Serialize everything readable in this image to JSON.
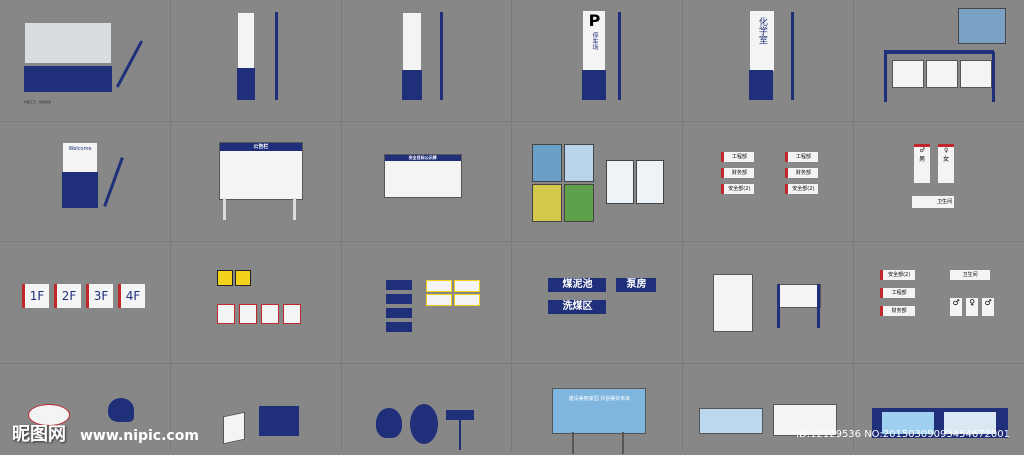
{
  "signs": {
    "floor_labels": [
      "1F",
      "2F",
      "3F",
      "4F"
    ],
    "parking_letter": "P",
    "parking_text": "停车场",
    "chem_text": "化学室",
    "welcome_text": "Welcome",
    "board_title": "公告栏",
    "safety_board_title": "安全目标公示牌",
    "room_labels": [
      "工程部",
      "财务部",
      "安全部(2)"
    ],
    "toilet_male": "男",
    "toilet_female": "女",
    "toilet_label": "卫生间",
    "coal_signs": [
      "煤泥池",
      "泵房",
      "洗煤区"
    ],
    "billboard_text": "建设美丽家园 共创美好未来",
    "footnote": "材质工艺：铝板烤漆"
  },
  "watermark": {
    "brand": "昵图网",
    "url": "www.nipic.com",
    "id": "ID:12129536 NO:20150309093454672001"
  }
}
